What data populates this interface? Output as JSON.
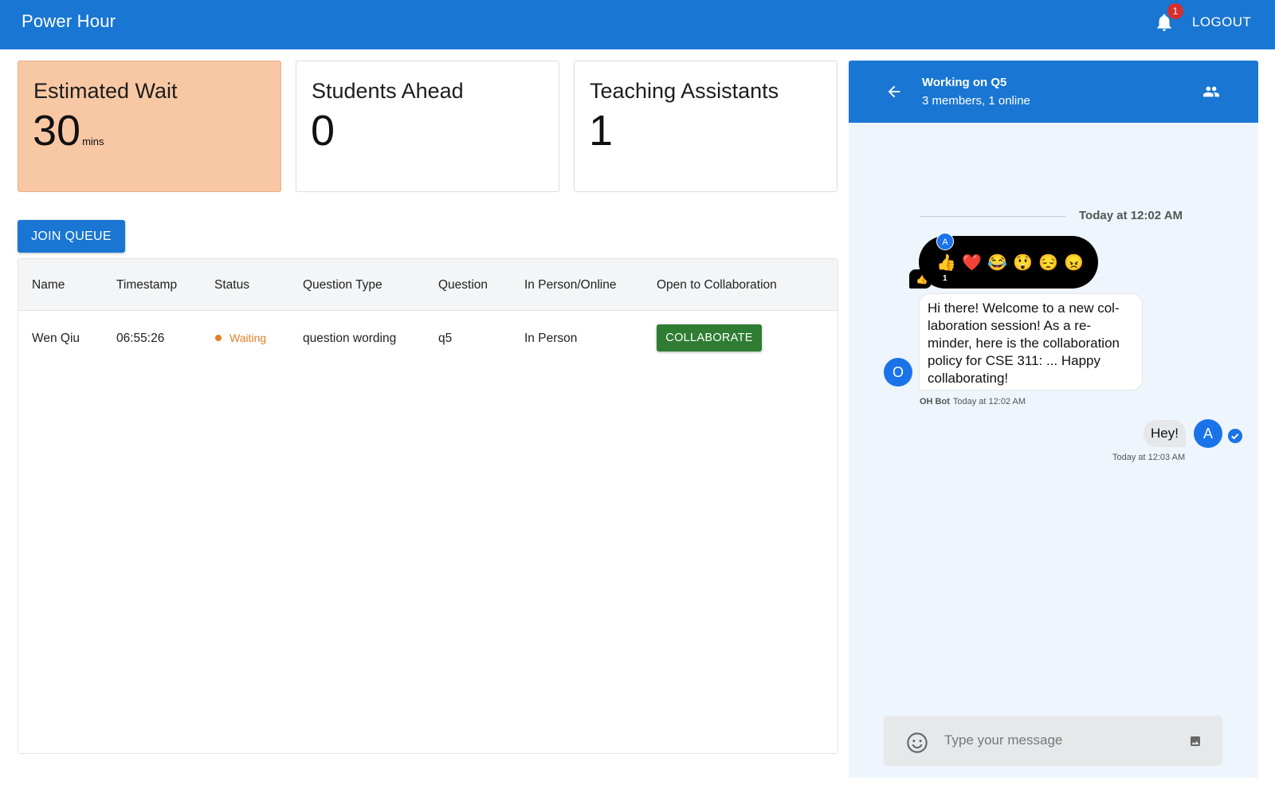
{
  "app": {
    "title": "Power Hour"
  },
  "header": {
    "notification_count": "1",
    "logout_label": "LOGOUT"
  },
  "stats": {
    "wait": {
      "title": "Estimated Wait",
      "value": "30",
      "unit": "mins"
    },
    "ahead": {
      "title": "Students Ahead",
      "value": "0"
    },
    "tas": {
      "title": "Teaching Assistants",
      "value": "1"
    }
  },
  "queue": {
    "join_label": "JOIN QUEUE",
    "columns": [
      "Name",
      "Timestamp",
      "Status",
      "Question Type",
      "Question",
      "In Person/Online",
      "Open to Collaboration"
    ],
    "rows": [
      {
        "name": "Wen Qiu",
        "timestamp": "06:55:26",
        "status": "Waiting",
        "question_type": "question wording",
        "question": "q5",
        "mode": "In Person",
        "collab_label": "COLLABORATE"
      }
    ]
  },
  "chat": {
    "title": "Working on Q5",
    "subtitle": "3 members, 1 online",
    "date_separator": "Today at 12:02 AM",
    "reactions": {
      "emojis": [
        "👍",
        "❤️",
        "😂",
        "😲",
        "😔",
        "😠"
      ],
      "reactor_initial": "A",
      "count": "1",
      "tail_emoji": "👍"
    },
    "messages": [
      {
        "sender_initial": "O",
        "text": "Hi there! Welcome to a new col-laboration session! As a re-minder, here is the collaboration policy for CSE 311: ... Happy collaborating!",
        "sender": "OH Bot",
        "time": "Today at 12:02 AM"
      },
      {
        "sender_initial": "A",
        "text": "Hey!",
        "time": "Today at 12:03 AM"
      }
    ],
    "composer_placeholder": "Type your message"
  },
  "colors": {
    "primary": "#1976d2",
    "wait_card": "#f8c8a4",
    "collaborate": "#2e7d32",
    "waiting": "#e67e22",
    "badge": "#d32f2f",
    "chat_bg": "#eef5fc"
  },
  "icons": {
    "bell": "bell-icon",
    "back": "arrow-left-icon",
    "members": "people-icon",
    "emoji": "smile-icon",
    "attach": "image-icon",
    "read": "check-circle-icon"
  }
}
